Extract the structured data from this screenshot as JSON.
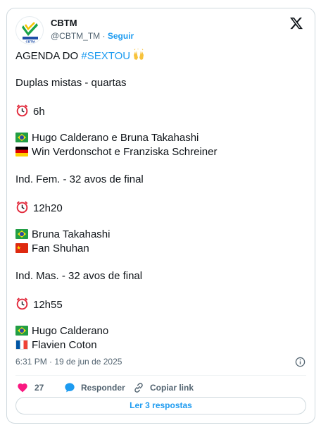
{
  "author": {
    "display_name": "CBTM",
    "handle": "@CBTM_TM",
    "separator": " · ",
    "follow_label": "Seguir"
  },
  "post": {
    "line1_prefix": "AGENDA DO ",
    "line1_hashtag": "#SEXTOU",
    "line2": "Duplas mistas - quartas",
    "time1": "6h",
    "match1_player1": "Hugo Calderano e Bruna Takahashi",
    "match1_player2": "Win Verdonschot e Franziska Schreiner",
    "line5": "Ind. Fem. - 32 avos de final",
    "time2": "12h20",
    "match2_player1": "Bruna Takahashi",
    "match2_player2": "Fan Shuhan",
    "line8": "Ind. Mas. - 32 avos de final",
    "time3": "12h55",
    "match3_player1": "Hugo Calderano",
    "match3_player2": "Flavien Coton"
  },
  "meta": {
    "timestamp": "6:31 PM · 19 de jun de 2025"
  },
  "actions": {
    "like_count": "27",
    "reply_label": "Responder",
    "copy_link_label": "Copiar link"
  },
  "replies_button_label": "Ler 3 respostas",
  "colors": {
    "accent": "#1d9bf0",
    "like": "#f91880",
    "text": "#0f1419",
    "muted": "#536471",
    "border": "#cfd9de"
  },
  "icons": {
    "close": "x-logo-icon",
    "clock": "alarm-clock-icon",
    "hands": "raising-hands-icon",
    "info": "info-icon",
    "like": "heart-icon",
    "reply": "speech-bubble-icon",
    "copy_link": "link-icon"
  }
}
